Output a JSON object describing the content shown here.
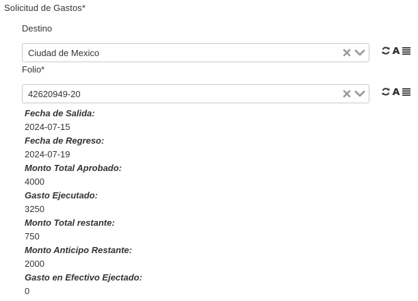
{
  "section_title": "Solicitud de Gastos*",
  "destino": {
    "label": "Destino",
    "value": "Ciudad de Mexico"
  },
  "folio": {
    "label": "Folio*",
    "value": "42620949-20"
  },
  "tools": [
    "refresh-icon",
    "font-icon",
    "list-icon"
  ],
  "details": [
    {
      "label": "Fecha de Salida:",
      "value": "2024-07-15"
    },
    {
      "label": "Fecha de Regreso:",
      "value": "2024-07-19"
    },
    {
      "label": "Monto Total Aprobado:",
      "value": "4000"
    },
    {
      "label": "Gasto Ejecutado:",
      "value": "3250"
    },
    {
      "label": "Monto Total restante:",
      "value": "750"
    },
    {
      "label": "Monto Anticipo Restante:",
      "value": "2000"
    },
    {
      "label": "Gasto en Efectivo Ejectado:",
      "value": "0"
    }
  ]
}
